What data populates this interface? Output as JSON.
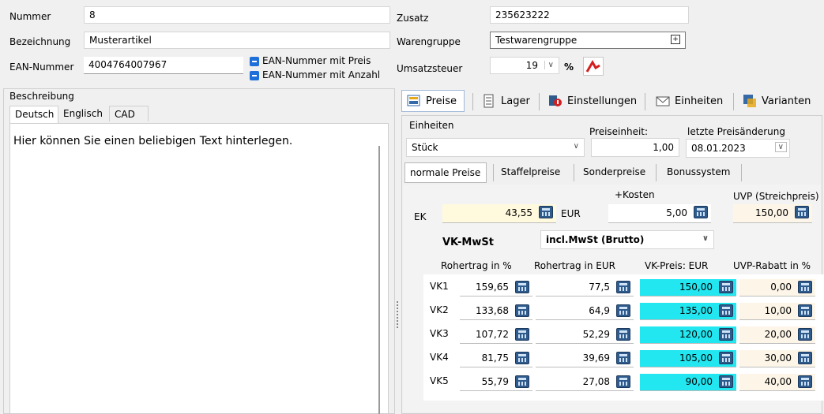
{
  "top_left": {
    "nummer_label": "Nummer",
    "nummer_value": "8",
    "bezeichnung_label": "Bezeichnung",
    "bezeichnung_value": "Musterartikel",
    "ean_label": "EAN-Nummer",
    "ean_value": "4004764007967",
    "ean_preis_label": "EAN-Nummer mit Preis",
    "ean_anzahl_label": "EAN-Nummer mit Anzahl"
  },
  "top_right": {
    "zusatz_label": "Zusatz",
    "zusatz_value": "235623222",
    "warengruppe_label": "Warengruppe",
    "warengruppe_value": "Testwarengruppe",
    "ust_label": "Umsatzsteuer",
    "ust_value": "19",
    "ust_unit": "%"
  },
  "beschreibung": {
    "title": "Beschreibung",
    "tabs": [
      "Deutsch",
      "Englisch",
      "CAD"
    ],
    "text": "Hier können Sie einen beliebigen Text hinterlegen."
  },
  "toolbar": {
    "preise": "Preise",
    "lager": "Lager",
    "einstellungen": "Einstellungen",
    "einheiten": "Einheiten",
    "varianten": "Varianten"
  },
  "einheiten": {
    "label": "Einheiten",
    "value": "Stück",
    "preiseinheit_label": "Preiseinheit:",
    "preiseinheit_value": "1,00",
    "letzte_label": "letzte Preisänderung",
    "letzte_value": "08.01.2023"
  },
  "subtabs": [
    "normale Preise",
    "Staffelpreise",
    "Sonderpreise",
    "Bonussystem"
  ],
  "ek": {
    "label": "EK",
    "value": "43,55",
    "currency": "EUR",
    "kosten_label": "+Kosten",
    "kosten_value": "5,00",
    "uvp_label": "UVP (Streichpreis)",
    "uvp_value": "150,00"
  },
  "vk": {
    "mwst_label": "VK-MwSt",
    "mwst_value": "incl.MwSt (Brutto)",
    "headers": [
      "Rohertrag in %",
      "Rohertrag in EUR",
      "VK-Preis: EUR",
      "UVP-Rabatt in %"
    ],
    "rows": [
      {
        "label": "VK1",
        "pct": "159,65",
        "eur": "77,5",
        "price": "150,00",
        "rabatt": "0,00"
      },
      {
        "label": "VK2",
        "pct": "133,68",
        "eur": "64,9",
        "price": "135,00",
        "rabatt": "10,00"
      },
      {
        "label": "VK3",
        "pct": "107,72",
        "eur": "52,29",
        "price": "120,00",
        "rabatt": "20,00"
      },
      {
        "label": "VK4",
        "pct": "81,75",
        "eur": "39,69",
        "price": "105,00",
        "rabatt": "30,00"
      },
      {
        "label": "VK5",
        "pct": "55,79",
        "eur": "27,08",
        "price": "90,00",
        "rabatt": "40,00"
      }
    ]
  }
}
